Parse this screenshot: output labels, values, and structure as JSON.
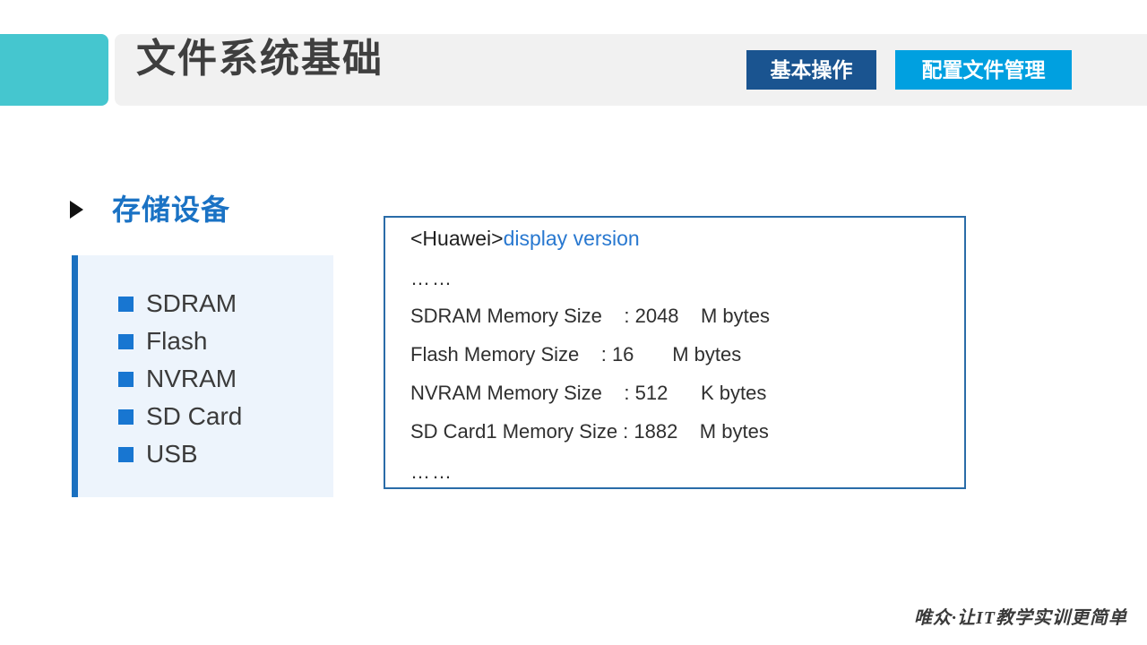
{
  "slide": {
    "title": "文件系统基础",
    "accent_color": "#45c6cf",
    "header_bg": "#f1f1f1"
  },
  "tabs": [
    {
      "label": "基本操作",
      "color": "#1a5490",
      "active": true
    },
    {
      "label": "配置文件管理",
      "color": "#00a0e0",
      "active": false
    }
  ],
  "left": {
    "heading": "存储设备",
    "heading_color": "#1a72c4",
    "panel_bg": "#edf4fc",
    "panel_bar_color": "#1a70c0",
    "bullet_color": "#1876d1",
    "items": [
      {
        "label": "SDRAM"
      },
      {
        "label": "Flash"
      },
      {
        "label": "NVRAM"
      },
      {
        "label": "SD Card"
      },
      {
        "label": "USB"
      }
    ]
  },
  "console": {
    "border_color": "#2a6ca8",
    "prompt": "<Huawei>",
    "command": "display version",
    "command_color": "#2878d0",
    "lines": [
      "……",
      "SDRAM Memory Size    : 2048    M bytes",
      "Flash Memory Size    : 16       M bytes",
      "NVRAM Memory Size    : 512      K bytes",
      "SD Card1 Memory Size : 1882    M bytes",
      "……"
    ]
  },
  "footer": {
    "text": "唯众·让IT教学实训更简单"
  }
}
